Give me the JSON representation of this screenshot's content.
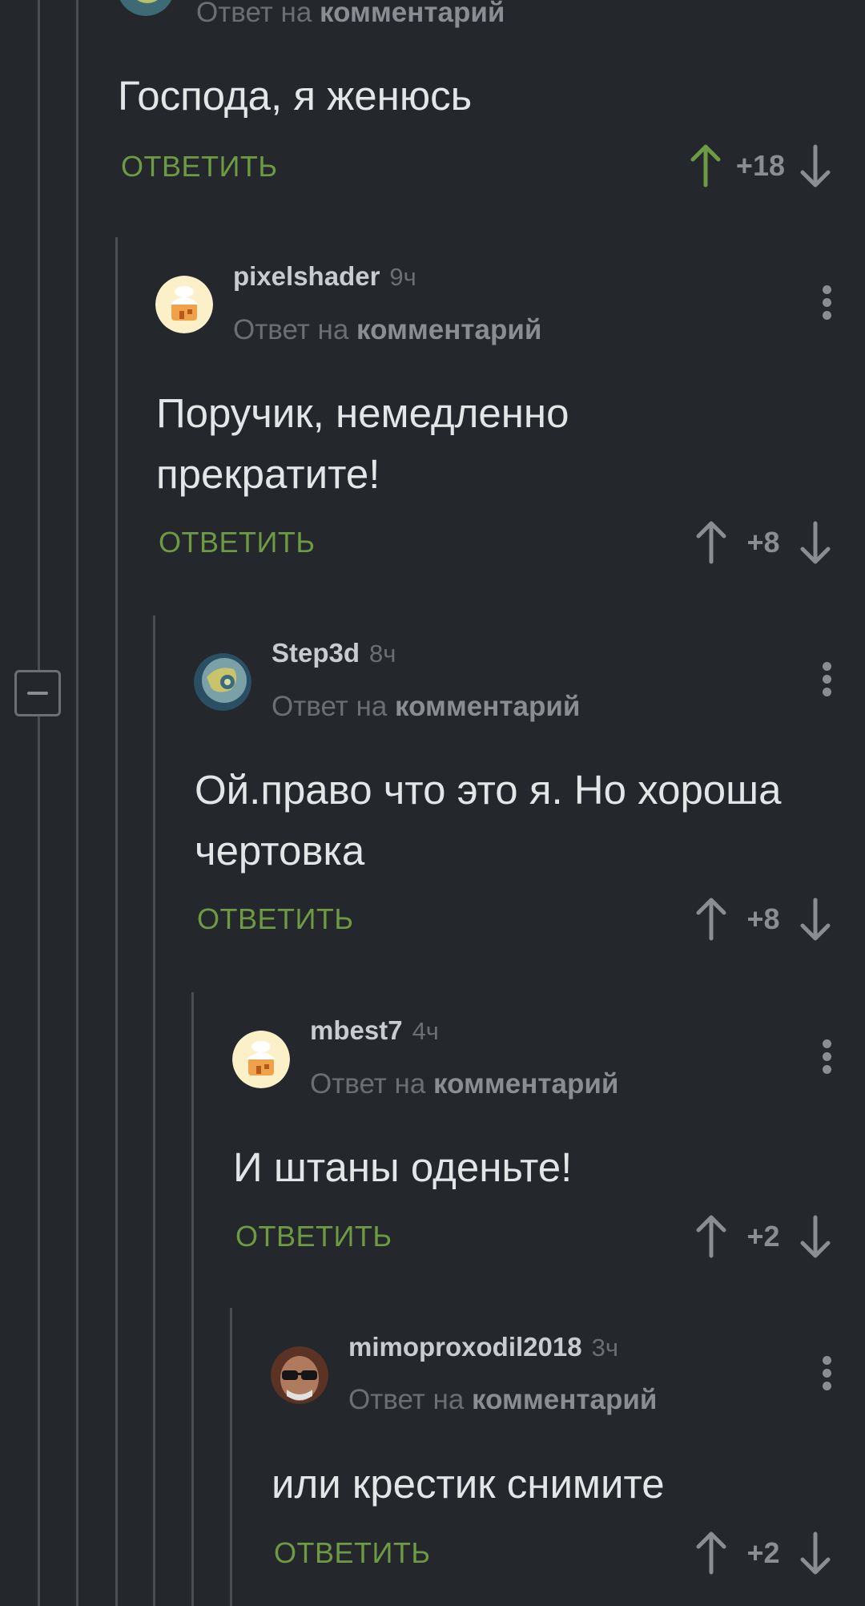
{
  "first_comment": {
    "reply_to_prefix": "Ответ на",
    "reply_to_target": "комментарий",
    "text": "Господа, я женюсь",
    "reply_label": "ОТВЕТИТЬ",
    "score": "+18",
    "upvoted": true
  },
  "comments": [
    {
      "username": "pixelshader",
      "time": "9ч",
      "avatar": "cake-house-avatar",
      "reply_to_prefix": "Ответ на",
      "reply_to_target": "комментарий",
      "text": "Поручик, немедленно\nпрекратите!",
      "reply_label": "ОТВЕТИТЬ",
      "score": "+8"
    },
    {
      "username": "Step3d",
      "time": "8ч",
      "avatar": "globe-avatar",
      "reply_to_prefix": "Ответ на",
      "reply_to_target": "комментарий",
      "text": "Ой.право что это я. Но хороша\nчертовка",
      "reply_label": "ОТВЕТИТЬ",
      "score": "+8"
    },
    {
      "username": "mbest7",
      "time": "4ч",
      "avatar": "cake-house-avatar",
      "reply_to_prefix": "Ответ на",
      "reply_to_target": "комментарий",
      "text": "И штаны оденьте!",
      "reply_label": "ОТВЕТИТЬ",
      "score": "+2"
    },
    {
      "username": "mimoproxodil2018",
      "time": "3ч",
      "avatar": "man-sunglasses-avatar",
      "reply_to_prefix": "Ответ на",
      "reply_to_target": "комментарий",
      "text": "или крестик снимите",
      "reply_label": "ОТВЕТИТЬ",
      "score": "+2"
    }
  ],
  "colors": {
    "background": "#24272b",
    "accent_green": "#6f9a44",
    "muted": "#8a8e93",
    "text": "#e4e5e7"
  }
}
